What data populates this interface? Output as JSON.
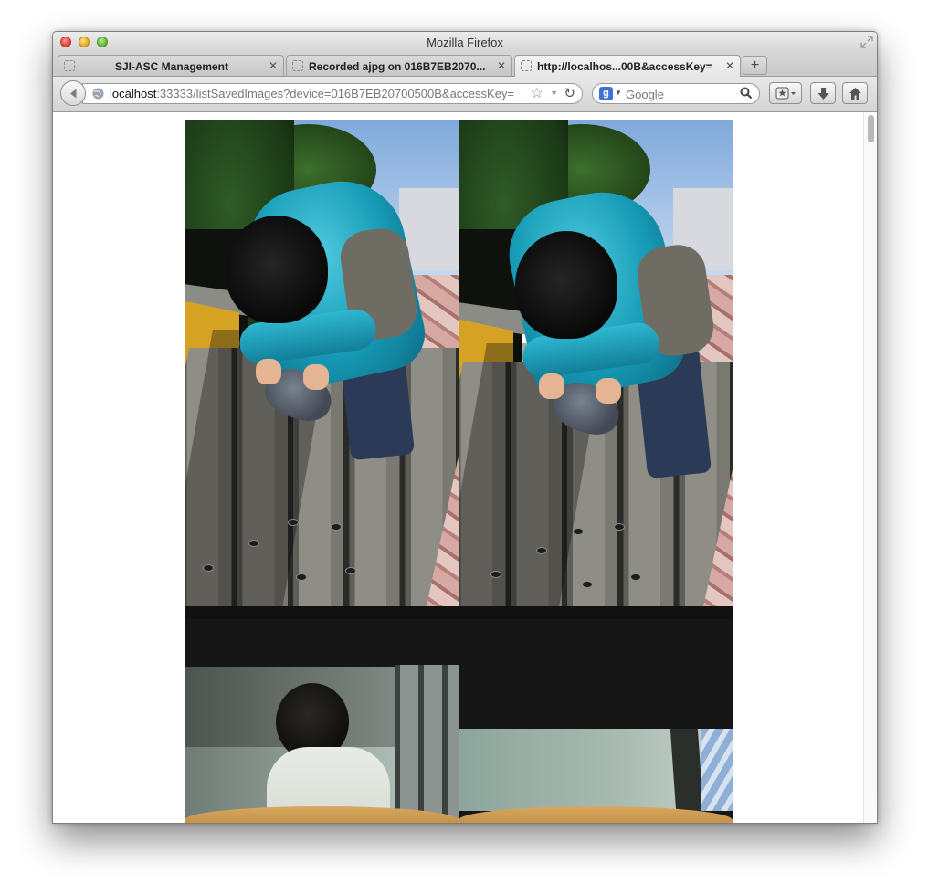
{
  "window": {
    "title": "Mozilla Firefox"
  },
  "tabs": [
    {
      "label": "SJI-ASC Management",
      "active": false
    },
    {
      "label": "Recorded ajpg on 016B7EB2070...",
      "active": false
    },
    {
      "label": "http://localhos...00B&accessKey=",
      "active": true
    }
  ],
  "newtab": {
    "label": "+"
  },
  "navbar": {
    "url_host": "localhost",
    "url_rest": ":33333/listSavedImages?device=016B7EB20700500B&accessKey=",
    "search_engine_letter": "g",
    "search_placeholder": "Google"
  },
  "content": {
    "images": [
      {
        "name": "pigeon-photo-left"
      },
      {
        "name": "pigeon-photo-right"
      },
      {
        "name": "room-photo-left"
      },
      {
        "name": "room-photo-right"
      }
    ]
  },
  "icons": {
    "close": "close-icon",
    "back": "back-arrow-icon",
    "globe": "globe-icon",
    "bookmark_star": "star-icon",
    "reload": "reload-icon",
    "search": "magnifier-icon",
    "bookmarks_menu": "bookmarks-menu-icon",
    "downloads": "download-arrow-icon",
    "home": "home-icon"
  },
  "colors": {
    "tab_active": "#eeeeee",
    "chrome": "#d6d6d6",
    "traffic_close": "#e0443b",
    "traffic_min": "#e9ac2b",
    "traffic_max": "#65b83e"
  }
}
